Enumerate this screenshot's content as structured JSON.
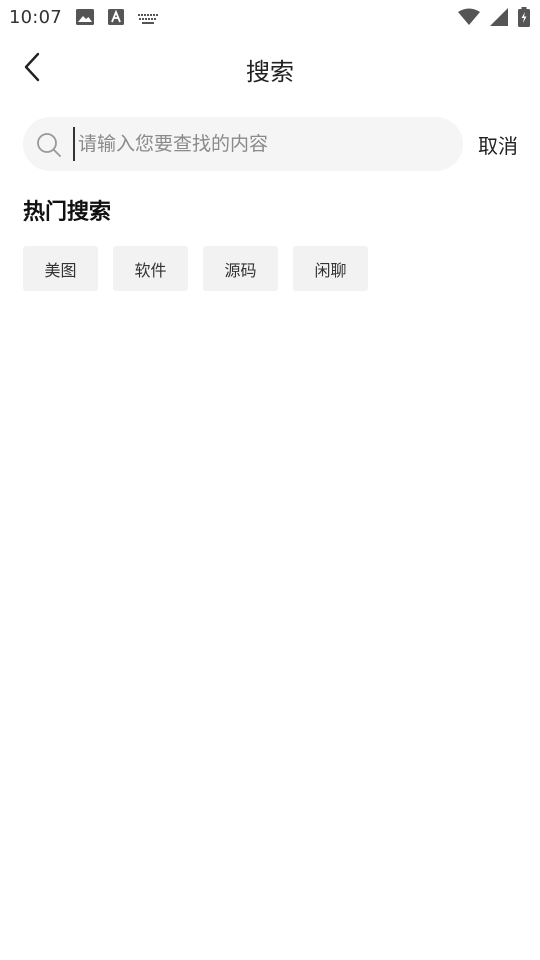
{
  "status_bar": {
    "time": "10:07",
    "icons_left": [
      "image-icon",
      "text-a-icon",
      "keyboard-icon"
    ],
    "icons_right": [
      "wifi-icon",
      "cell-signal-icon",
      "battery-charging-icon"
    ]
  },
  "header": {
    "title": "搜索",
    "back_icon": "chevron-left-icon"
  },
  "search": {
    "placeholder": "请输入您要查找的内容",
    "value": "",
    "cancel_label": "取消"
  },
  "hot_search": {
    "title": "热门搜索",
    "tags": [
      "美图",
      "软件",
      "源码",
      "闲聊"
    ]
  },
  "colors": {
    "background": "#ffffff",
    "search_bg": "#f5f5f5",
    "tag_bg": "#f2f2f2",
    "placeholder": "#8a8a8a",
    "text": "#222222"
  }
}
